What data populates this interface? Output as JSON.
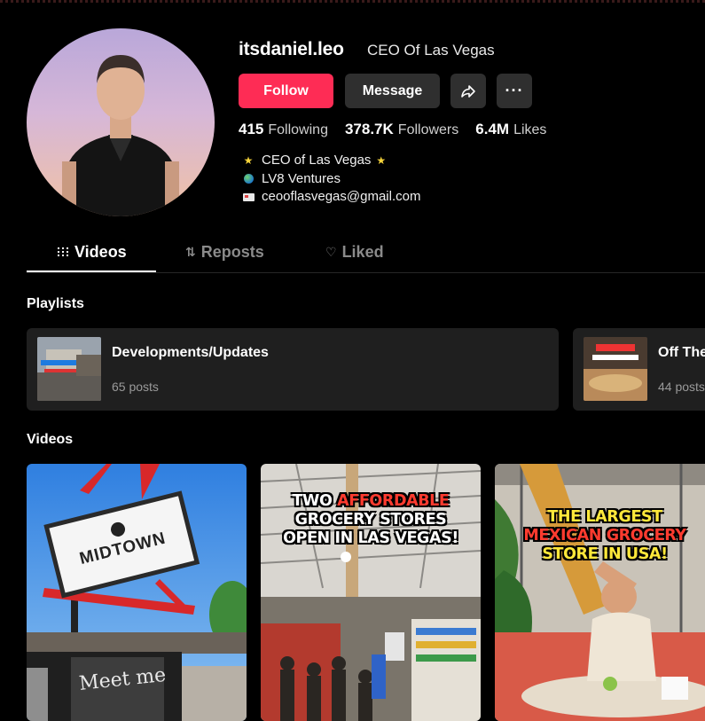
{
  "profile": {
    "username": "itsdaniel.leo",
    "nickname": "CEO Of Las Vegas",
    "follow_label": "Follow",
    "message_label": "Message",
    "more_label": "···",
    "stats": [
      {
        "value": "415",
        "label": "Following"
      },
      {
        "value": "378.7K",
        "label": "Followers"
      },
      {
        "value": "6.4M",
        "label": "Likes"
      }
    ],
    "bio": [
      "CEO of Las Vegas",
      "LV8 Ventures",
      "ceooflasvegas@gmail.com"
    ]
  },
  "tabs": [
    {
      "label": "Videos",
      "icon": "grid-icon",
      "active": true
    },
    {
      "label": "Reposts",
      "icon": "repost-icon",
      "active": false
    },
    {
      "label": "Liked",
      "icon": "heart-outline-icon",
      "active": false
    }
  ],
  "playlists": {
    "title": "Playlists",
    "items": [
      {
        "name": "Developments/Updates",
        "posts": "65 posts"
      },
      {
        "name": "Off The",
        "posts": "44 posts"
      }
    ]
  },
  "videos": {
    "title": "Videos",
    "items": [
      {
        "caption": ""
      },
      {
        "caption_lines": [
          [
            "TWO ",
            "AFFORDABLE"
          ],
          [
            "GROCERY STORES"
          ],
          [
            "OPEN IN LAS VEGAS!"
          ]
        ]
      },
      {
        "caption_lines": [
          [
            "THE LARGEST"
          ],
          [
            "MEXICAN GROCERY"
          ],
          [
            "STORE IN USA!"
          ]
        ]
      }
    ]
  },
  "colors": {
    "accent": "#fe2c55",
    "background": "#000000",
    "card": "#1f1f1f"
  }
}
